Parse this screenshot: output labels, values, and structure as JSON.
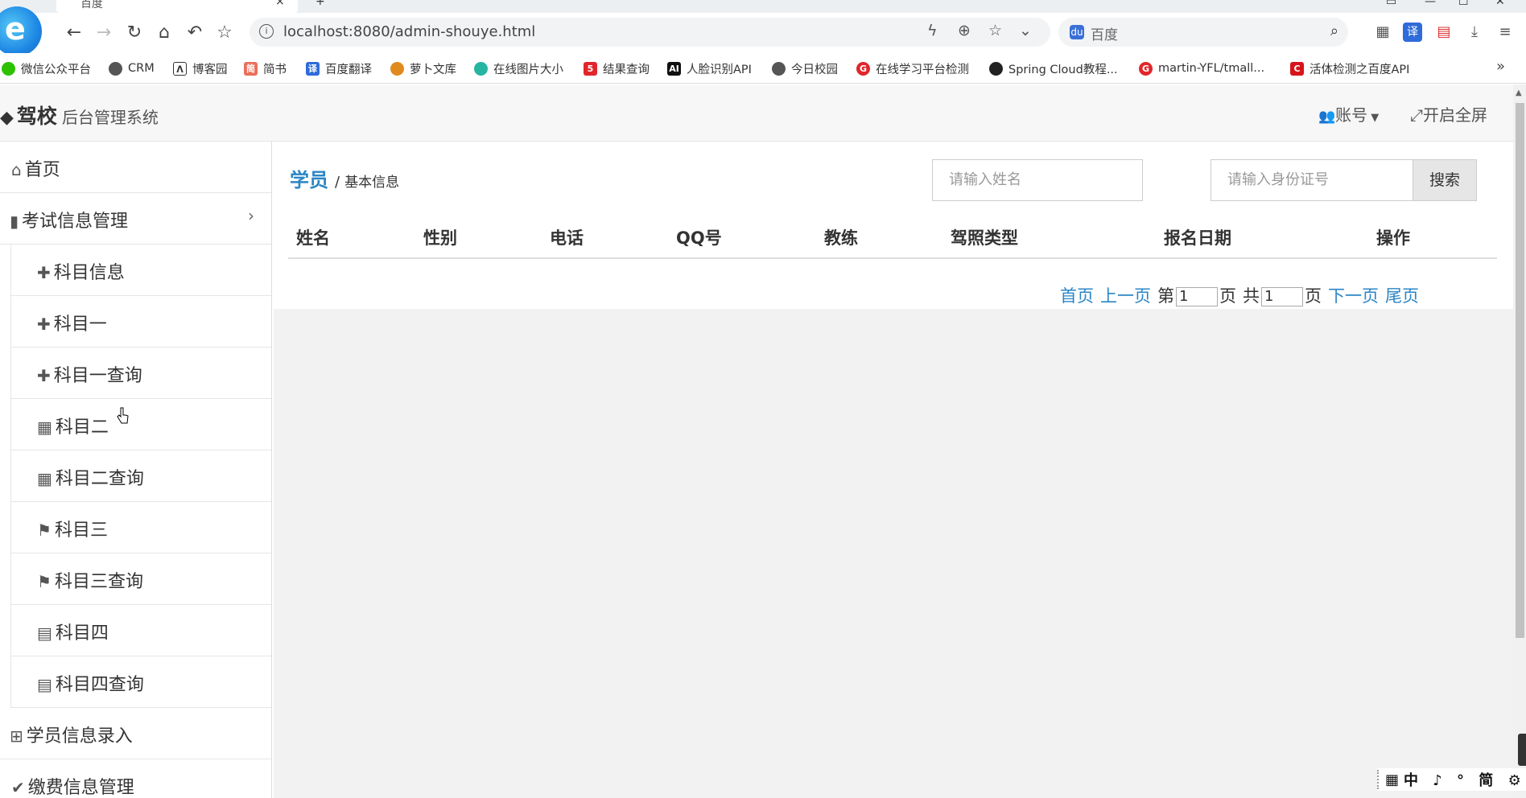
{
  "browser": {
    "tab_title": "百度",
    "url": "localhost:8080/admin-shouye.html",
    "search_placeholder": "百度",
    "bookmarks": [
      {
        "label": "微信公众平台",
        "color": "#2dc100"
      },
      {
        "label": "CRM",
        "color": "#555555"
      },
      {
        "label": "博客园",
        "color": "#333333"
      },
      {
        "label": "简书",
        "color": "#ea6f5a"
      },
      {
        "label": "百度翻译",
        "color": "#2f6bd9"
      },
      {
        "label": "萝卜文库",
        "color": "#e08a1e"
      },
      {
        "label": "在线图片大小",
        "color": "#26b5a0"
      },
      {
        "label": "结果查询",
        "color": "#e0262c"
      },
      {
        "label": "人脸识别API",
        "color": "#111111"
      },
      {
        "label": "今日校园",
        "color": "#555555"
      },
      {
        "label": "在线学习平台检测",
        "color": "#e0262c"
      },
      {
        "label": "Spring Cloud教程...",
        "color": "#222222"
      },
      {
        "label": "martin-YFL/tmall...",
        "color": "#e0262c"
      },
      {
        "label": "活体检测之百度API",
        "color": "#d6141b"
      }
    ],
    "more": "»"
  },
  "header": {
    "brand": "驾校",
    "subtitle": "后台管理系统",
    "account_label": "账号",
    "fullscreen_label": "开启全屏"
  },
  "sidebar": {
    "home": "首页",
    "exam_group": "考试信息管理",
    "sub_items": [
      {
        "label": "科目信息",
        "icon": "puzzle-icon"
      },
      {
        "label": "科目一",
        "icon": "puzzle-icon"
      },
      {
        "label": "科目一查询",
        "icon": "puzzle-icon"
      },
      {
        "label": "科目二",
        "icon": "grid-icon"
      },
      {
        "label": "科目二查询",
        "icon": "grid-icon"
      },
      {
        "label": "科目三",
        "icon": "bookmark-icon"
      },
      {
        "label": "科目三查询",
        "icon": "bookmark-icon"
      },
      {
        "label": "科目四",
        "icon": "calendar-icon"
      },
      {
        "label": "科目四查询",
        "icon": "calendar-icon"
      }
    ],
    "student_entry": "学员信息录入",
    "fee_group": "缴费信息管理"
  },
  "main": {
    "breadcrumb_main": "学员",
    "breadcrumb_sep": "/",
    "breadcrumb_sub": "基本信息",
    "name_placeholder": "请输入姓名",
    "id_placeholder": "请输入身份证号",
    "search_button": "搜索",
    "columns": [
      "姓名",
      "性别",
      "电话",
      "QQ号",
      "教练",
      "驾照类型",
      "报名日期",
      "操作"
    ],
    "pager": {
      "first": "首页",
      "prev": "上一页",
      "page_prefix": "第",
      "page_value": "1",
      "page_suffix": "页",
      "total_prefix": "共",
      "total_value": "1",
      "total_suffix": "页",
      "next": "下一页",
      "last": "尾页"
    }
  },
  "ime": "中 ♪ ° 简 ⚙",
  "colors": {
    "link": "#2b86c5",
    "header_bg": "#f7f7f7",
    "content_bg": "#f2f2f2"
  }
}
